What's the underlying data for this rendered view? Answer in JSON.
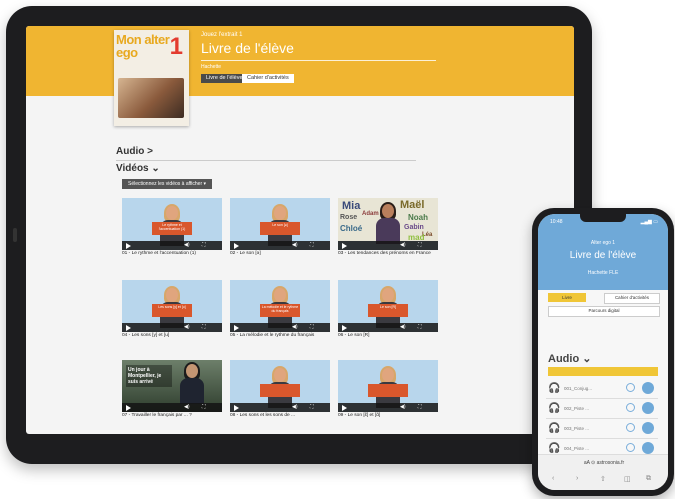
{
  "tablet": {
    "breadcrumb": "Jouez l'extrait 1",
    "page_title": "Livre de l'élève",
    "publisher": "Hachette",
    "btn_dark": "Livre de l'élève",
    "btn_light": "Cahier d'activités",
    "cover": {
      "title": "Mon alter ego",
      "number": "1"
    },
    "audio_section": "Audio >",
    "videos_section": "Vidéos ⌄",
    "filter_label": "Sélectionnez les vidéos à afficher ▾",
    "videos": [
      {
        "title": "01 - Le rythme et l'accentuation (1)",
        "sign": "Le rythme et l'accentuation (1)"
      },
      {
        "title": "02 - Le son [ə]",
        "sign": "Le son [ə]"
      },
      {
        "title": "03 - Les tendances des prénoms en France",
        "sign": ""
      },
      {
        "title": "04 - Les sons [y] et [u]",
        "sign": "Les sons [y] et [u]"
      },
      {
        "title": "05 - La mélodie et le rythme du français",
        "sign": "La mélodie et le rythme du français"
      },
      {
        "title": "06 - Le son [R]",
        "sign": "Le son [R]"
      },
      {
        "title": "07 - Travailler le français par ... ?",
        "sign": ""
      },
      {
        "title": "08 - Les sons et les sons de ...",
        "sign": ""
      },
      {
        "title": "09 - Le son [ɛ̃] et [ɑ̃]",
        "sign": ""
      }
    ],
    "word_cloud": [
      "Mia",
      "Maël",
      "Rose",
      "Noah",
      "Adam",
      "Gabin",
      "Chloé",
      "Léa",
      "mad",
      "Lina"
    ],
    "boy_video_text": "Un jour à Montpellier, je suis arrivé"
  },
  "phone": {
    "time": "10:48",
    "subtitle": "Alter ego 1",
    "title": "Livre de l'élève",
    "meta": "Hachette FLE",
    "tab_active": "Livre",
    "tab_other": "Cahier d'activités",
    "wide_btn": "Parcours digital",
    "audio_label": "Audio ⌄",
    "rows": [
      "001_Conjug...",
      "002_Piste ...",
      "003_Piste ...",
      "004_Piste ..."
    ],
    "url": "aA    ⊙ astrosonia.fr",
    "nav": [
      "‹",
      "›",
      "⇧",
      "◫",
      "⧉"
    ]
  }
}
